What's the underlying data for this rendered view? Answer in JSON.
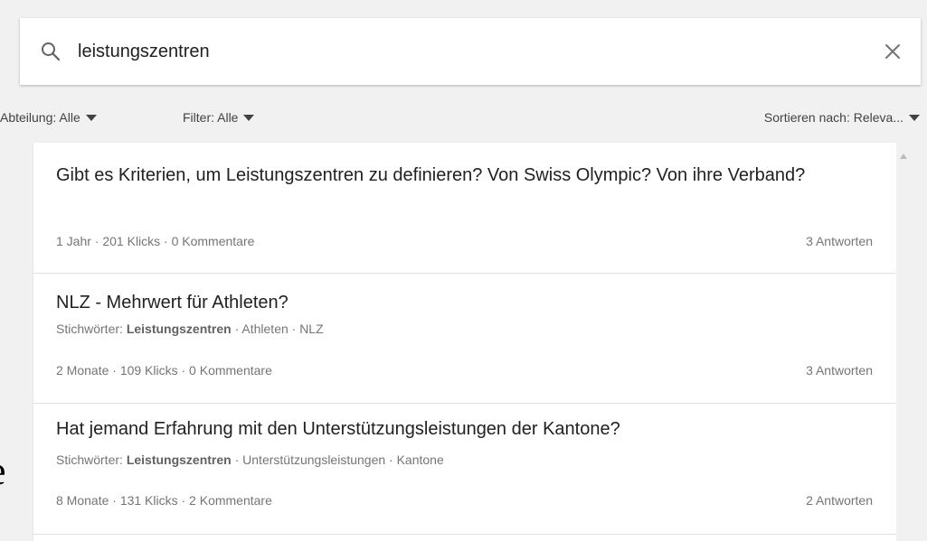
{
  "search": {
    "query": "leistungszentren",
    "placeholder": ""
  },
  "filters": {
    "department_label": "Abteilung: Alle",
    "filter_label": "Filter: Alle",
    "sort_label": "Sortieren nach: Releva..."
  },
  "results": [
    {
      "title": "Gibt es Kriterien, um Leistungszentren zu definieren? Von Swiss Olympic? Von ihre Verband?",
      "tags_prefix": "",
      "tags_bold": "",
      "tags_rest": "",
      "meta": "1 Jahr · 201 Klicks · 0 Kommentare",
      "answers": "3 Antworten"
    },
    {
      "title": "NLZ - Mehrwert für Athleten?",
      "tags_prefix": "Stichwörter: ",
      "tags_bold": "Leistungszentren",
      "tags_rest": " · Athleten · NLZ",
      "meta": "2 Monate · 109 Klicks · 0 Kommentare",
      "answers": "3 Antworten"
    },
    {
      "title": "Hat jemand Erfahrung mit den Unterstützungsleistungen der Kantone?",
      "tags_prefix": "Stichwörter: ",
      "tags_bold": "Leistungszentren",
      "tags_rest": " · Unterstützungsleistungen · Kantone",
      "meta": "8 Monate · 131 Klicks · 2 Kommentare",
      "answers": "2 Antworten"
    }
  ],
  "edge_glyph": "e",
  "icons": {
    "search": "search-icon",
    "close": "close-icon",
    "caret": "caret-down-icon"
  },
  "colors": {
    "background": "#f1f1f1",
    "card": "#ffffff",
    "text_primary": "#212121",
    "text_secondary": "#757575"
  }
}
